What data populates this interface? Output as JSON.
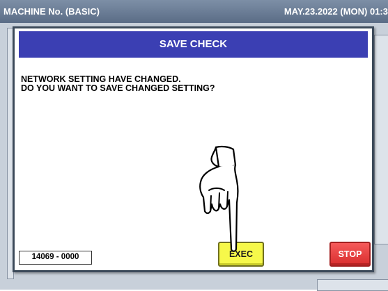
{
  "title_bar": {
    "left_text": "MACHINE No. (BASIC)",
    "right_text": "MAY.23.2022 (MON) 01:3"
  },
  "dialog": {
    "title": "SAVE CHECK",
    "message_line1": "NETWORK SETTING HAVE CHANGED.",
    "message_line2": "DO YOU WANT TO SAVE CHANGED SETTING?",
    "code": "14069 - 0000",
    "exec_label": "EXEC",
    "stop_label": "STOP"
  },
  "icons": {
    "pointer": "pointing-hand-icon"
  },
  "colors": {
    "header": "#3b3fb3",
    "exec": "#f6f84a",
    "stop": "#e23b3b"
  }
}
